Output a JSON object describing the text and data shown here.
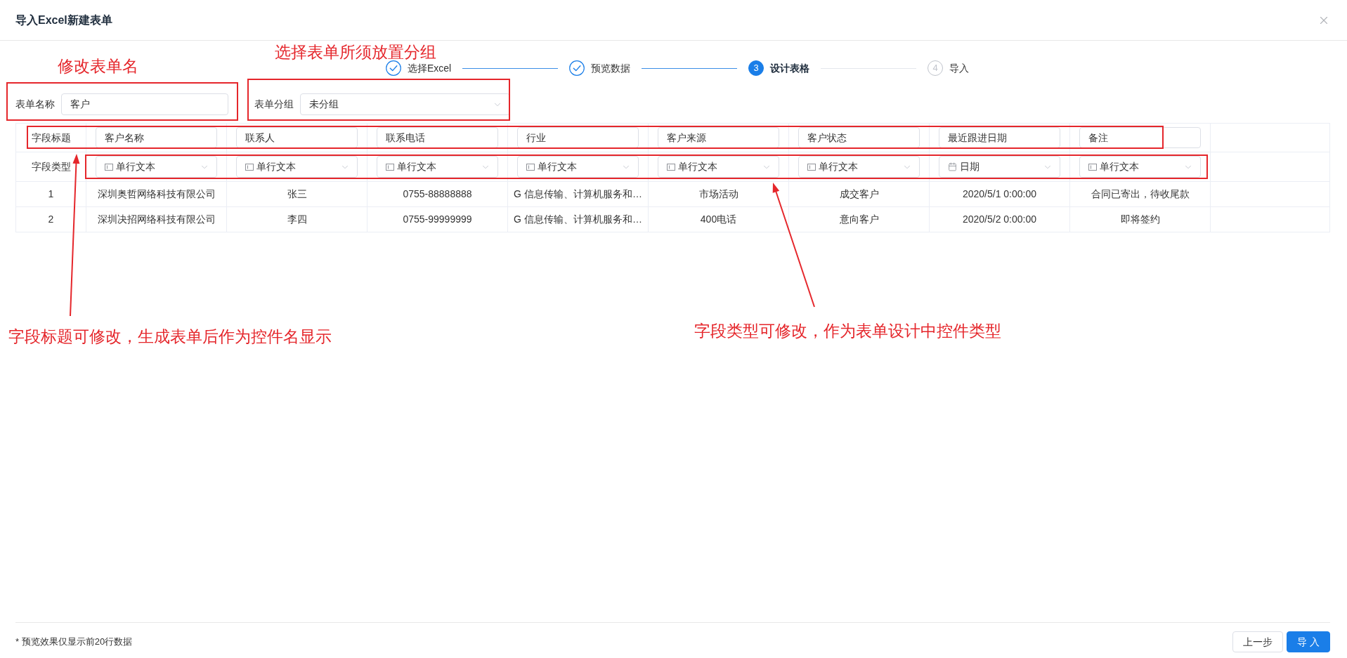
{
  "dialog": {
    "title": "导入Excel新建表单"
  },
  "steps": [
    {
      "label": "选择Excel",
      "done": true,
      "active": false
    },
    {
      "label": "预览数据",
      "done": true,
      "active": false
    },
    {
      "label": "设计表格",
      "done": false,
      "active": true,
      "number": "3"
    },
    {
      "label": "导入",
      "done": false,
      "active": false,
      "number": "4"
    }
  ],
  "form": [
    {
      "kind": "input",
      "label": "表单名称",
      "value": "客户"
    },
    {
      "kind": "select",
      "label": "表单分组",
      "value": "未分组"
    }
  ],
  "table": {
    "title_row_label": "字段标题",
    "type_row_label": "字段类型",
    "columns": [
      {
        "title": "客户名称",
        "type": {
          "kind": "text",
          "label": "单行文本"
        }
      },
      {
        "title": "联系人",
        "type": {
          "kind": "text",
          "label": "单行文本"
        }
      },
      {
        "title": "联系电话",
        "type": {
          "kind": "text",
          "label": "单行文本"
        }
      },
      {
        "title": "行业",
        "type": {
          "kind": "text",
          "label": "单行文本"
        }
      },
      {
        "title": "客户来源",
        "type": {
          "kind": "text",
          "label": "单行文本"
        }
      },
      {
        "title": "客户状态",
        "type": {
          "kind": "text",
          "label": "单行文本"
        }
      },
      {
        "title": "最近跟进日期",
        "type": {
          "kind": "date",
          "label": "日期"
        }
      },
      {
        "title": "备注",
        "type": {
          "kind": "text",
          "label": "单行文本"
        }
      }
    ],
    "rows": [
      {
        "number": "1",
        "cells": [
          "深圳奥哲网络科技有限公司",
          "张三",
          "0755-88888888",
          "G 信息传输、计算机服务和…",
          "市场活动",
          "成交客户",
          "2020/5/1 0:00:00",
          "合同已寄出，待收尾款"
        ]
      },
      {
        "number": "2",
        "cells": [
          "深圳决招网络科技有限公司",
          "李四",
          "0755-99999999",
          "G 信息传输、计算机服务和…",
          "400电话",
          "意向客户",
          "2020/5/2 0:00:00",
          "即将签约"
        ]
      }
    ]
  },
  "annotations": [
    "修改表单名",
    "选择表单所须放置分组",
    "字段标题可修改，生成表单后作为控件名显示",
    "字段类型可修改，作为表单设计中控件类型"
  ],
  "footer": {
    "note": "* 预览效果仅显示前20行数据",
    "buttons": [
      {
        "label": "上一步",
        "kind": "default"
      },
      {
        "label": "导 入",
        "kind": "primary"
      }
    ]
  }
}
